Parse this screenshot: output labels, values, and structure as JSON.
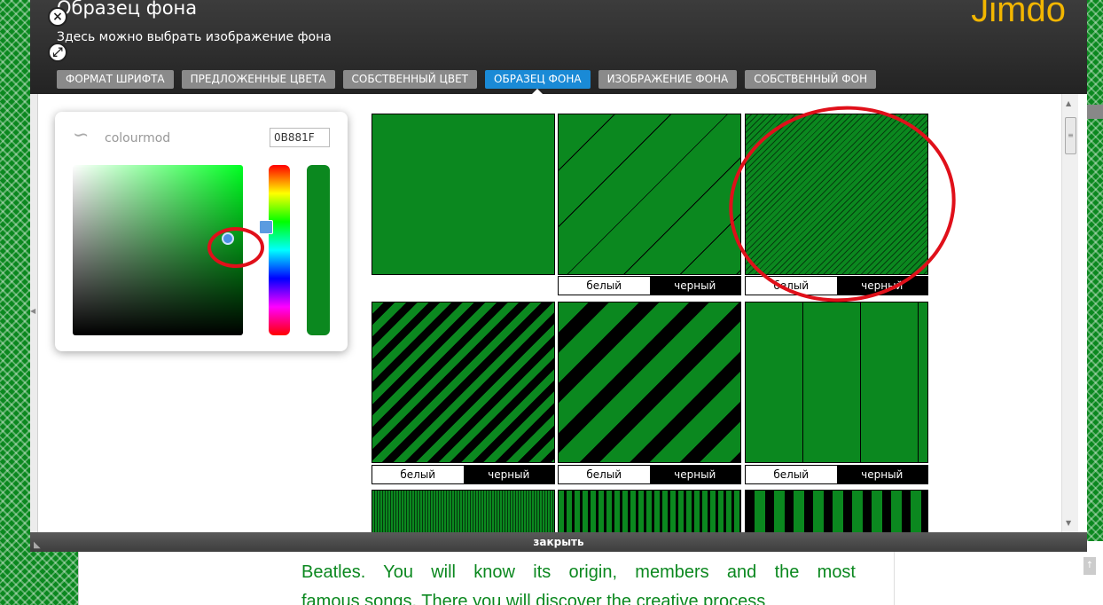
{
  "dialog": {
    "title": "Образец фона",
    "subtitle": "Здесь можно выбрать изображение фона",
    "logo": "Jimdo",
    "close_label": "закрыть",
    "tabs": [
      {
        "label": "ФОРМАТ ШРИФТА",
        "active": false
      },
      {
        "label": "ПРЕДЛОЖЕННЫЕ ЦВЕТА",
        "active": false
      },
      {
        "label": "СОБСТВЕННЫЙ ЦВЕТ",
        "active": false
      },
      {
        "label": "ОБРАЗЕЦ ФОНА",
        "active": true
      },
      {
        "label": "ИЗОБРАЖЕНИЕ ФОНА",
        "active": false
      },
      {
        "label": "СОБСТВЕННЫЙ ФОН",
        "active": false
      }
    ]
  },
  "colourmod": {
    "name": "colourmod",
    "hex_value": "0B881F",
    "selected_color": "#0b881f"
  },
  "patterns": {
    "white_label": "белый",
    "black_label": "черный"
  },
  "site": {
    "text_line1": "Beatles. You will know its origin, members and the most",
    "text_line2": "famous songs. There you will discover the creative process"
  },
  "icons": {
    "close": "close-icon",
    "expand": "expand-icon"
  }
}
